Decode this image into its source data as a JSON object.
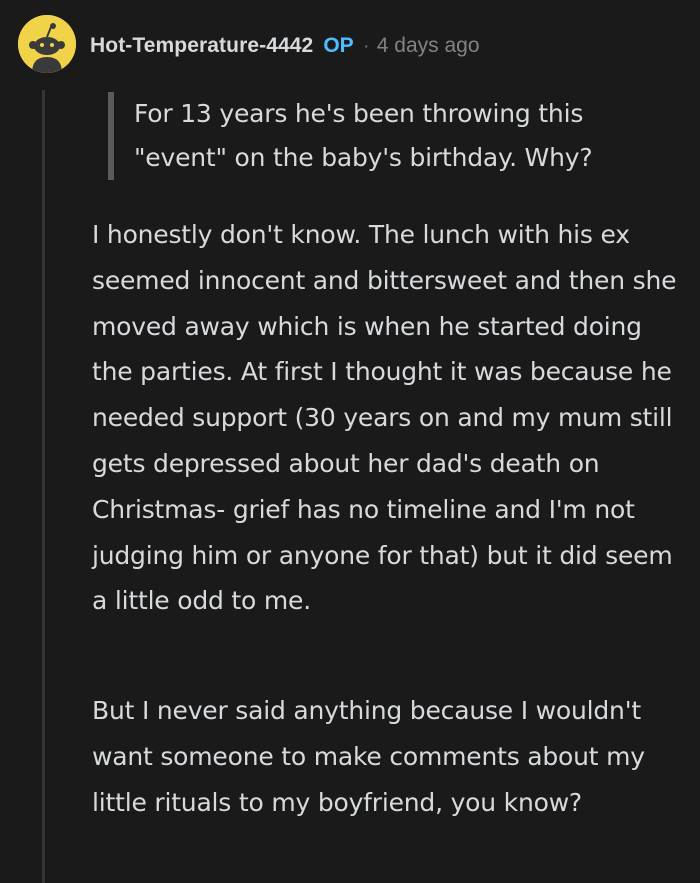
{
  "comment": {
    "author": "Hot-Temperature-4442",
    "op_badge": "OP",
    "separator": "·",
    "timestamp": "4 days ago",
    "avatar_icon": "snoo-avatar-icon",
    "avatar_color": "#f1d34a",
    "quote": "For 13 years he's been throwing this \"event\" on the baby's birthday. Why?",
    "paragraphs": [
      "I honestly don't know. The lunch with his ex seemed innocent and bittersweet and then she moved away which is when he started doing the parties. At first I thought it was because he needed support (30 years on and my mum still gets depressed about her dad's death on Christmas- grief has no timeline and I'm not judging him or anyone for that) but it did seem a little odd to me.",
      "But I never said anything because I wouldn't want someone to make comments about my little rituals to my boyfriend, you know?"
    ]
  },
  "colors": {
    "background": "#1a1a1b",
    "text": "#d7dadc",
    "op_badge": "#4fbcff",
    "muted": "#818384",
    "quote_bar": "#5a5a5c"
  }
}
